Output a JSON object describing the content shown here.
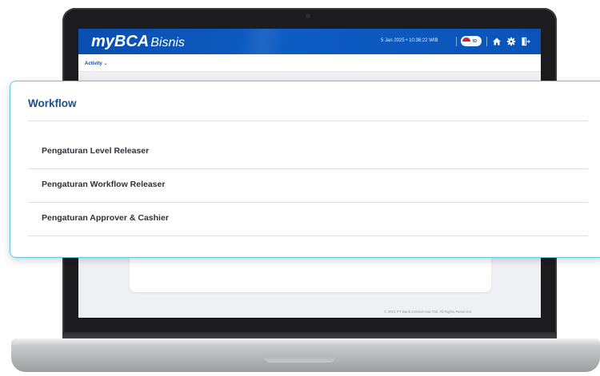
{
  "app": {
    "logo_my": "my",
    "logo_bca": "BCA",
    "logo_bisnis": "Bisnis"
  },
  "header": {
    "datetime": "5 Jan 2025 • 10:36:22 WIB",
    "language": "ID",
    "icons": [
      "home-icon",
      "gear-icon",
      "logout-icon"
    ]
  },
  "subnav": {
    "activity_label": "Activity ⌄"
  },
  "footer": {
    "copyright": "© 2021 PT Bank Central Asia Tbk. All Rights Reserved."
  },
  "workflow": {
    "title": "Workflow",
    "items": [
      {
        "label": "Pengaturan Level Releaser"
      },
      {
        "label": "Pengaturan Workflow Releaser"
      },
      {
        "label": "Pengaturan Approver & Cashier"
      }
    ]
  },
  "colors": {
    "brand_blue": "#0a4fb0",
    "title_blue": "#1b4f8f",
    "card_border": "#5ec8e6",
    "flag_red": "#d9202a"
  }
}
